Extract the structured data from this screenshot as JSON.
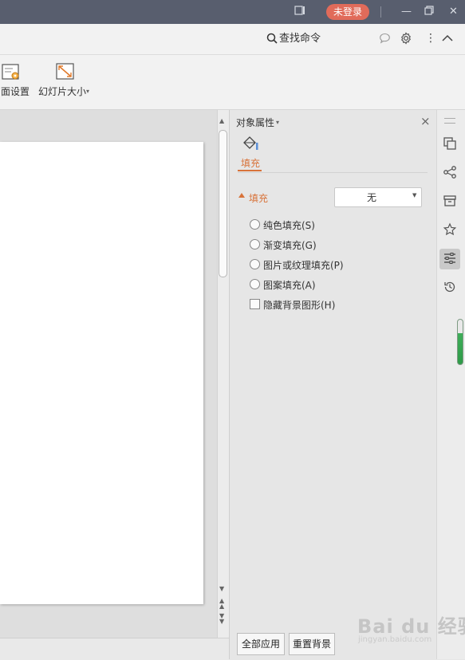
{
  "titlebar": {
    "login_label": "未登录"
  },
  "commandbar": {
    "search_label": "查找命令"
  },
  "ribbon": {
    "page_setup_label": "面设置",
    "slide_size_label": "幻灯片大小",
    "slide_size_caret": "▾"
  },
  "panel": {
    "title": "对象属性",
    "title_caret": "▾",
    "close": "×",
    "tab_fill": "填充",
    "section_title": "填充",
    "fill_select_value": "无",
    "options": [
      {
        "type": "radio",
        "label": "纯色填充(S)"
      },
      {
        "type": "radio",
        "label": "渐变填充(G)"
      },
      {
        "type": "radio",
        "label": "图片或纹理填充(P)"
      },
      {
        "type": "radio",
        "label": "图案填充(A)"
      },
      {
        "type": "checkbox",
        "label": "隐藏背景图形(H)"
      }
    ],
    "apply_all_label": "全部应用",
    "reset_bg_label": "重置背景"
  },
  "strip": {
    "icons": [
      "copy-icon",
      "share-icon",
      "archive-icon",
      "star-icon",
      "properties-icon",
      "history-icon"
    ]
  },
  "colors": {
    "accent": "#d8733a",
    "login_badge": "#e16b5a",
    "titlebar": "#585e6e"
  },
  "watermark": {
    "text": "Bai du 经验",
    "sub": "jingyan.baidu.com"
  }
}
